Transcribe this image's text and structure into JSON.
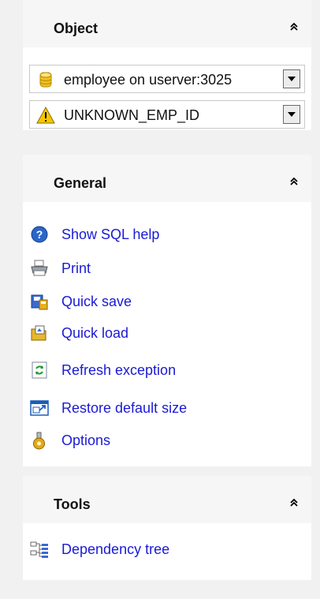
{
  "object_panel": {
    "title": "Object",
    "database_combo": {
      "value": "employee on userver:3025",
      "icon": "database-icon"
    },
    "exception_combo": {
      "value": "UNKNOWN_EMP_ID",
      "icon": "warning-icon"
    }
  },
  "general_panel": {
    "title": "General",
    "items": [
      {
        "label": "Show SQL help",
        "icon": "help-icon"
      },
      {
        "label": "Print",
        "icon": "printer-icon"
      },
      {
        "label": "Quick save",
        "icon": "quick-save-icon"
      },
      {
        "label": "Quick load",
        "icon": "quick-load-icon"
      },
      {
        "label": "Refresh exception",
        "icon": "refresh-icon"
      },
      {
        "label": "Restore default size",
        "icon": "restore-size-icon"
      },
      {
        "label": "Options",
        "icon": "options-icon"
      }
    ]
  },
  "tools_panel": {
    "title": "Tools",
    "items": [
      {
        "label": "Dependency tree",
        "icon": "dependency-tree-icon"
      }
    ]
  },
  "colors": {
    "link": "#1a1ad6",
    "panel_background": "#ffffff",
    "page_background": "#f1f1f1"
  }
}
